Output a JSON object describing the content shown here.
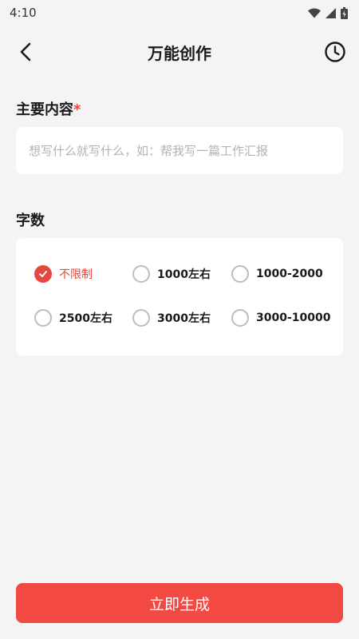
{
  "status_bar": {
    "time": "4:10"
  },
  "nav": {
    "title": "万能创作"
  },
  "content_section": {
    "title": "主要内容",
    "required_mark": "*",
    "placeholder": "想写什么就写什么，如：帮我写一篇工作汇报",
    "value": ""
  },
  "word_count_section": {
    "title": "字数",
    "selected_index": 0,
    "options": [
      {
        "label": "不限制"
      },
      {
        "label": "1000左右"
      },
      {
        "label": "1000-2000"
      },
      {
        "label": "2500左右"
      },
      {
        "label": "3000左右"
      },
      {
        "label": "3000-10000"
      }
    ]
  },
  "submit_button": {
    "label": "立即生成"
  },
  "colors": {
    "accent": "#e5483f",
    "button": "#f24a42",
    "background": "#f4f4f4"
  }
}
